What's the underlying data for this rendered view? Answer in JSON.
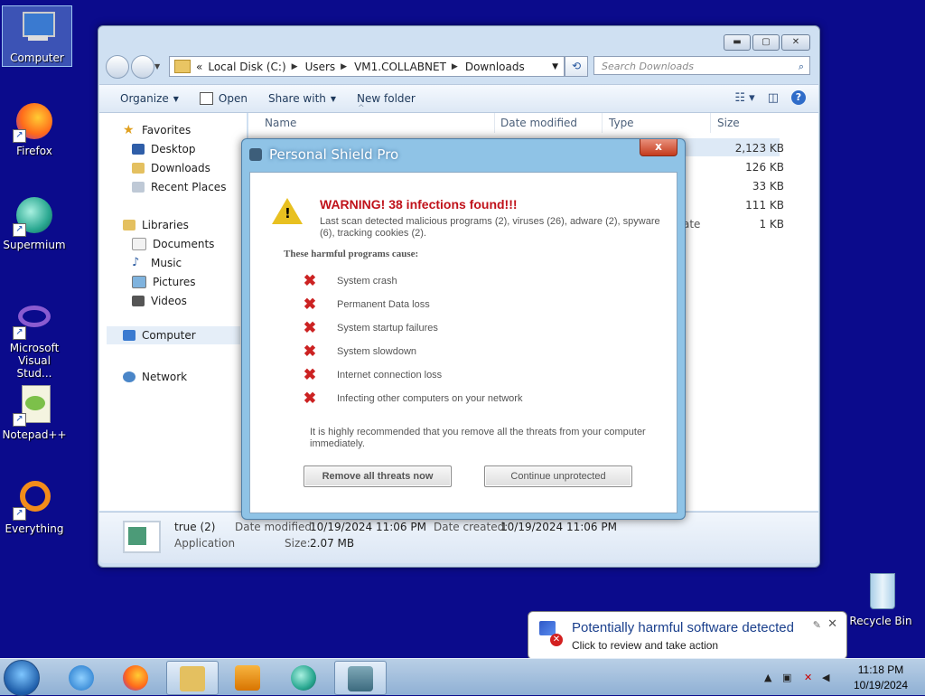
{
  "desktop": {
    "icons": [
      {
        "label": "Computer"
      },
      {
        "label": "Firefox"
      },
      {
        "label": "Supermium"
      },
      {
        "label": "Microsoft Visual Stud..."
      },
      {
        "label": "Notepad++"
      },
      {
        "label": "Everything"
      },
      {
        "label": "Recycle Bin"
      }
    ]
  },
  "explorer": {
    "breadcrumb": [
      "«",
      "Local Disk (C:)",
      "Users",
      "VM1.COLLABNET",
      "Downloads"
    ],
    "search_placeholder": "Search Downloads",
    "toolbar": {
      "organize": "Organize",
      "open": "Open",
      "share_with": "Share with",
      "new_folder": "New folder"
    },
    "nav": {
      "favorites": "Favorites",
      "desktop": "Desktop",
      "downloads": "Downloads",
      "recent_places": "Recent Places",
      "libraries": "Libraries",
      "documents": "Documents",
      "music": "Music",
      "pictures": "Pictures",
      "videos": "Videos",
      "computer": "Computer",
      "network": "Network"
    },
    "columns": {
      "name": "Name",
      "date_modified": "Date modified",
      "type": "Type",
      "size": "Size"
    },
    "sizes": [
      "2,123 KB",
      "126 KB",
      "33 KB",
      "111 KB",
      "1 KB"
    ],
    "partial_type": "ate",
    "details": {
      "name": "true (2)",
      "type": "Application",
      "date_modified_label": "Date modified:",
      "date_modified": "10/19/2024 11:06 PM",
      "date_created_label": "Date created:",
      "date_created": "10/19/2024 11:06 PM",
      "size_label": "Size:",
      "size": "2.07 MB"
    }
  },
  "popup": {
    "title": "Personal Shield Pro",
    "close": "x",
    "warning_title": "WARNING! 38 infections found!!!",
    "warning_sub": "Last scan detected malicious programs (2), viruses (26), adware (2), spyware (6), tracking cookies (2).",
    "causes_heading": "These harmful programs cause:",
    "threats": [
      "System crash",
      "Permanent Data loss",
      "System startup failures",
      "System slowdown",
      "Internet connection loss",
      "Infecting other computers on your network"
    ],
    "recommendation": "It is highly recommended that you remove all the threats from your computer immediately.",
    "remove_button": "Remove all threats now",
    "continue_button": "Continue unprotected"
  },
  "notification": {
    "title": "Potentially harmful software detected",
    "subtitle": "Click to review and take action"
  },
  "clock": {
    "time": "11:18 PM",
    "date": "10/19/2024"
  }
}
